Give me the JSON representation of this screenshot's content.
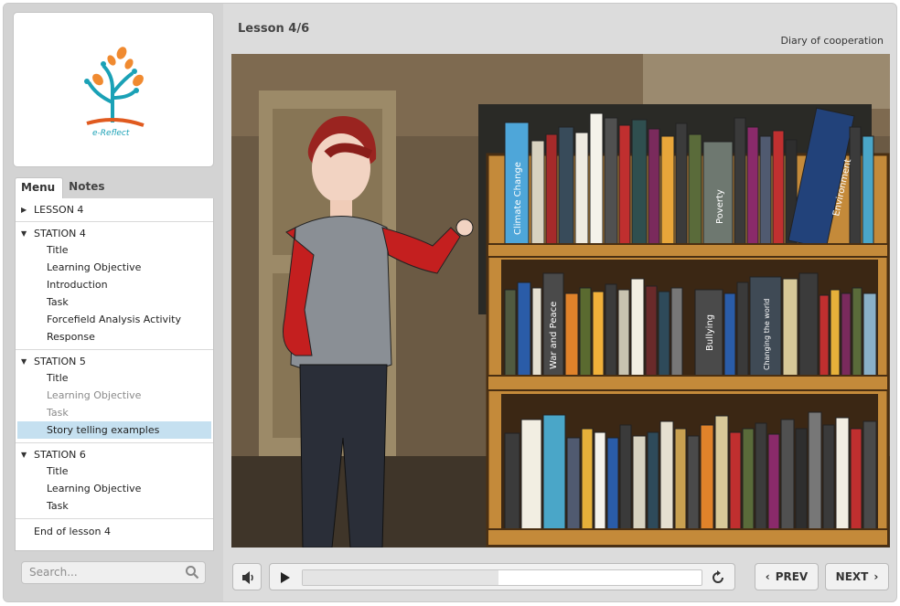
{
  "app": {
    "logo_text": "e-Reflect"
  },
  "tabs": {
    "menu": "Menu",
    "notes": "Notes"
  },
  "menu": {
    "lesson4": "LESSON 4",
    "station4": {
      "title": "STATION 4",
      "items": [
        "Title",
        "Learning Objective",
        "Introduction",
        "Task",
        "Forcefield Analysis Activity",
        "Response"
      ]
    },
    "station5": {
      "title": "STATION 5",
      "items": [
        "Title",
        "Learning Objective",
        "Task",
        "Story telling examples"
      ]
    },
    "station6": {
      "title": "STATION 6",
      "items": [
        "Title",
        "Learning Objective",
        "Task"
      ]
    },
    "end": "End of lesson 4"
  },
  "search": {
    "placeholder": "Search..."
  },
  "header": {
    "lesson": "Lesson 4/6",
    "course": "Diary of cooperation"
  },
  "books": {
    "climate": "Climate Change",
    "poverty": "Poverty",
    "environment": "Environment",
    "war": "War and Peace",
    "bullying": "Bullying",
    "changing": "Changing the world"
  },
  "controls": {
    "prev": "PREV",
    "next": "NEXT",
    "progress": 0.49
  },
  "colors": {
    "selected": "#c5e0f0",
    "accent": "#2a88c8"
  }
}
